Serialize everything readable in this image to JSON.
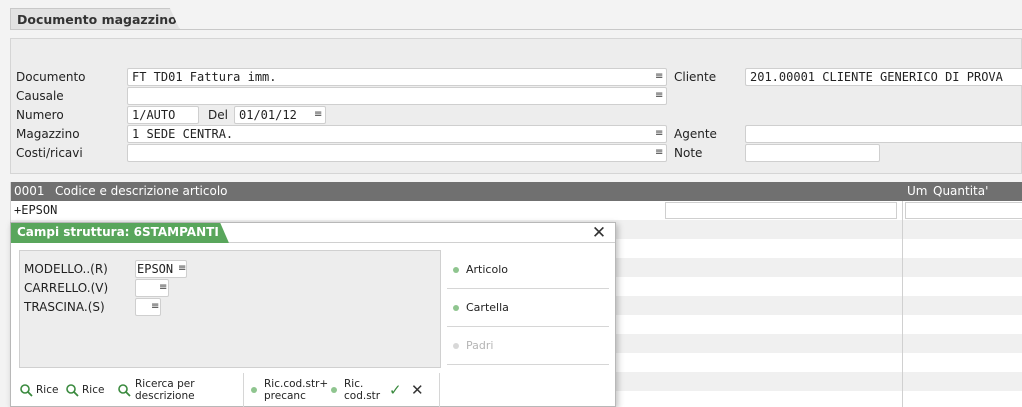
{
  "window": {
    "title": "Documento magazzino"
  },
  "header": {
    "documento": {
      "label": "Documento",
      "value": "FT  TD01 Fattura imm."
    },
    "causale": {
      "label": "Causale",
      "value": ""
    },
    "numero": {
      "label": "Numero",
      "value": "1/AUTO"
    },
    "del": {
      "label": "Del",
      "value": "01/01/12"
    },
    "magazzino": {
      "label": "Magazzino",
      "value": "  1 SEDE CENTRA."
    },
    "costi": {
      "label": "Costi/ricavi",
      "value": ""
    },
    "cliente": {
      "label": "Cliente",
      "value": "201.00001 CLIENTE GENERICO DI PROVA"
    },
    "agente": {
      "label": "Agente",
      "value": ""
    },
    "note": {
      "label": "Note",
      "value": ""
    },
    "dropdown_glyph": "≡"
  },
  "grid": {
    "row_num": "0001",
    "col_article": "Codice e descrizione articolo",
    "col_um": "Um",
    "col_qty": "Quantita'",
    "first_row_code": "+EPSON"
  },
  "popup": {
    "title": "Campi struttura: 6STAMPANTI",
    "close_icon": "✕",
    "fields": [
      {
        "label": "MODELLO..(R)",
        "value": "EPSON"
      },
      {
        "label": "CARRELLO.(V)",
        "value": ""
      },
      {
        "label": "TRASCINA.(S)",
        "value": ""
      }
    ],
    "side_buttons": [
      {
        "label": "Articolo",
        "enabled": true
      },
      {
        "label": "Cartella",
        "enabled": true
      },
      {
        "label": "Padri",
        "enabled": false
      }
    ],
    "toolbar": {
      "rice1": "Rice",
      "rice2": "Rice",
      "ricerca_l1": "Ricerca per",
      "ricerca_l2": "descrizione",
      "riccod_l1": "Ric.cod.str+",
      "riccod_l2": "precanc",
      "riccodstr_l1": "Ric.",
      "riccodstr_l2": "cod.str",
      "confirm_icon": "✓",
      "cancel_icon": "✕"
    }
  },
  "colors": {
    "popup_accent": "#59a65c",
    "grid_header": "#707070"
  }
}
